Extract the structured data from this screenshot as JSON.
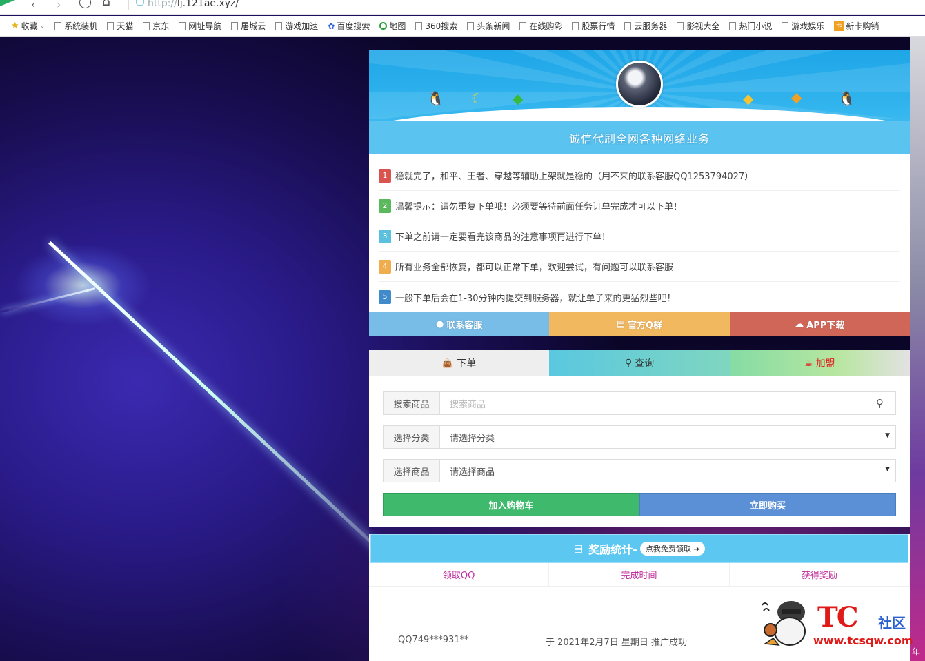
{
  "browser": {
    "url_scheme": "http://",
    "url_host": "lj.121ae.xyz/"
  },
  "bookmarks": [
    {
      "label": "收藏",
      "icon": "star-icon"
    },
    {
      "label": "系统装机",
      "icon": "page-icon"
    },
    {
      "label": "天猫",
      "icon": "page-icon"
    },
    {
      "label": "京东",
      "icon": "page-icon"
    },
    {
      "label": "网址导航",
      "icon": "page-icon"
    },
    {
      "label": "屠城云",
      "icon": "page-icon"
    },
    {
      "label": "游戏加速",
      "icon": "page-icon"
    },
    {
      "label": "百度搜索",
      "icon": "paw-icon"
    },
    {
      "label": "地图",
      "icon": "map-icon"
    },
    {
      "label": "360搜索",
      "icon": "page-icon"
    },
    {
      "label": "头条新闻",
      "icon": "page-icon"
    },
    {
      "label": "在线购彩",
      "icon": "page-icon"
    },
    {
      "label": "股票行情",
      "icon": "page-icon"
    },
    {
      "label": "云服务器",
      "icon": "page-icon"
    },
    {
      "label": "影视大全",
      "icon": "page-icon"
    },
    {
      "label": "热门小说",
      "icon": "page-icon"
    },
    {
      "label": "游戏娱乐",
      "icon": "page-icon"
    },
    {
      "label": "新卡购销",
      "icon": "card-icon"
    }
  ],
  "banner": {
    "title": "诚信代刷全网各种网络业务"
  },
  "notices": [
    {
      "num": "1",
      "color": "#d9534f",
      "text": "稳就完了，和平、王者、穿越等辅助上架就是稳的（用不来的联系客服QQ1253794027）"
    },
    {
      "num": "2",
      "color": "#5cb85c",
      "text": "温馨提示：请勿重复下单哦！必须要等待前面任务订单完成才可以下单！"
    },
    {
      "num": "3",
      "color": "#5bc0de",
      "text": "下单之前请一定要看完该商品的注意事项再进行下单！"
    },
    {
      "num": "4",
      "color": "#f0ad4e",
      "text": "所有业务全部恢复，都可以正常下单，欢迎尝试，有问题可以联系客服"
    },
    {
      "num": "5",
      "color": "#428bca",
      "text": "一般下单后会在1-30分钟内提交到服务器，就让单子来的更猛烈些吧！"
    }
  ],
  "quick_buttons": [
    {
      "label": "联系客服",
      "icon": "qq-icon",
      "color": "#78bde8"
    },
    {
      "label": "官方Q群",
      "icon": "group-icon",
      "color": "#f2b860"
    },
    {
      "label": "APP下载",
      "icon": "cloud-download-icon",
      "color": "#d06658"
    }
  ],
  "tabs": [
    {
      "label": "下单",
      "icon": "bag-icon"
    },
    {
      "label": "查询",
      "icon": "search-icon"
    },
    {
      "label": "加盟",
      "icon": "coffee-icon"
    }
  ],
  "form": {
    "search_label": "搜索商品",
    "search_placeholder": "搜索商品",
    "category_label": "选择分类",
    "category_value": "请选择分类",
    "product_label": "选择商品",
    "product_value": "请选择商品",
    "add_cart": "加入购物车",
    "buy_now": "立即购买"
  },
  "stats": {
    "title": "奖励统计-",
    "pill": "点我免费领取",
    "columns": [
      "领取QQ",
      "完成时间",
      "获得奖励"
    ],
    "rows": [
      {
        "qq": "QQ749***931**",
        "time": "于 2021年2月7日 星期日 推广成功"
      }
    ]
  },
  "watermark": {
    "brand": "TC",
    "brand_cn": "社区",
    "url": "www.tcsqw.com"
  },
  "corner_text": "年"
}
